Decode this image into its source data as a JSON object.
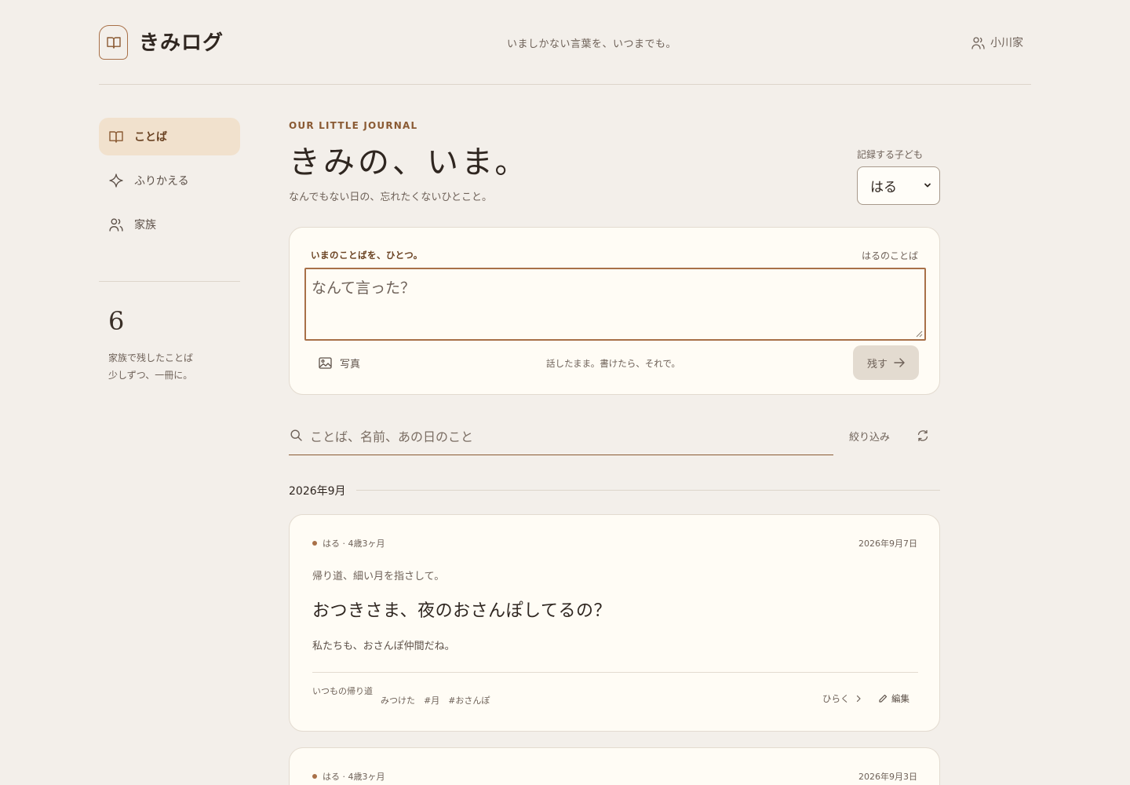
{
  "app": {
    "name": "きみログ",
    "tagline": "いましかない言葉を、いつまでも。",
    "user": "小川家"
  },
  "sidebar": {
    "items": [
      {
        "label": "ことば",
        "icon": "book-icon",
        "active": true
      },
      {
        "label": "ふりかえる",
        "icon": "sparkle-icon",
        "active": false
      },
      {
        "label": "家族",
        "icon": "family-icon",
        "active": false
      }
    ],
    "stat": {
      "count": "6",
      "label": "家族で残したことば",
      "sub": "少しずつ、一冊に。"
    }
  },
  "main": {
    "eyebrow": "OUR LITTLE JOURNAL",
    "title": "きみの、いま。",
    "subtitle": "なんでもない日の、忘れたくないひとこと。",
    "child_select": {
      "label": "記録する子ども",
      "value": "はる"
    }
  },
  "compose": {
    "label": "いまのことばを、ひとつ。",
    "owner": "はるのことば",
    "placeholder": "なんて言った？",
    "photo_label": "写真",
    "hint": "話したまま。書けたら、それで。",
    "submit_label": "残す"
  },
  "search": {
    "placeholder": "ことば、名前、あの日のこと",
    "filter_label": "絞り込み"
  },
  "month_label": "2026年9月",
  "entries": [
    {
      "child": "はる · 4歳3ヶ月",
      "date": "2026年9月7日",
      "context": "帰り道、細い月を指さして。",
      "quote": "おつきさま、夜のおさんぽしてるの？",
      "reply": "私たちも、おさんぽ仲間だね。",
      "place": "いつもの帰り道",
      "tags": [
        "みつけた",
        "#月",
        "#おさんぽ"
      ],
      "open_label": "ひらく",
      "edit_label": "編集"
    },
    {
      "child": "はる · 4歳3ヶ月",
      "date": "2026年9月3日"
    }
  ],
  "colors": {
    "background": "#f3efea",
    "accent": "#a87048",
    "card": "#fffcf5",
    "active_nav": "#f1e1cd"
  }
}
